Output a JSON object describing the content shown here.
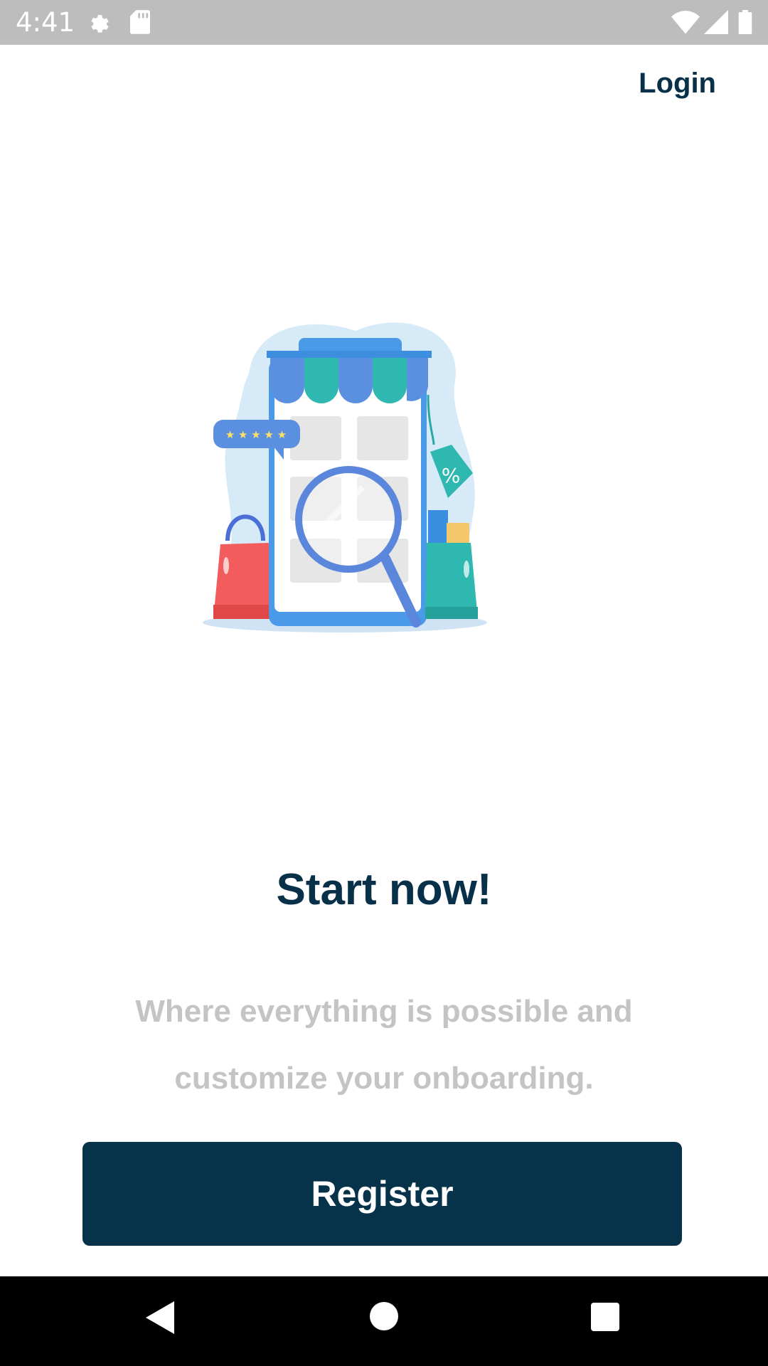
{
  "status_bar": {
    "time": "4:41",
    "icons": [
      "gear-icon",
      "sd-card-icon",
      "wifi-icon",
      "cell-signal-icon",
      "battery-icon"
    ]
  },
  "header": {
    "login_label": "Login"
  },
  "illustration": {
    "rating_stars": 5,
    "tag_text": "%"
  },
  "main": {
    "title": "Start now!",
    "subtitle": "Where everything is possible and customize your onboarding.",
    "register_label": "Register"
  },
  "colors": {
    "brand_dark": "#06324A",
    "subtitle_gray": "#C4C4C4",
    "status_bar": "#BDBDBD"
  },
  "nav_bar": {
    "icons": [
      "back-icon",
      "home-icon",
      "recents-icon"
    ]
  }
}
